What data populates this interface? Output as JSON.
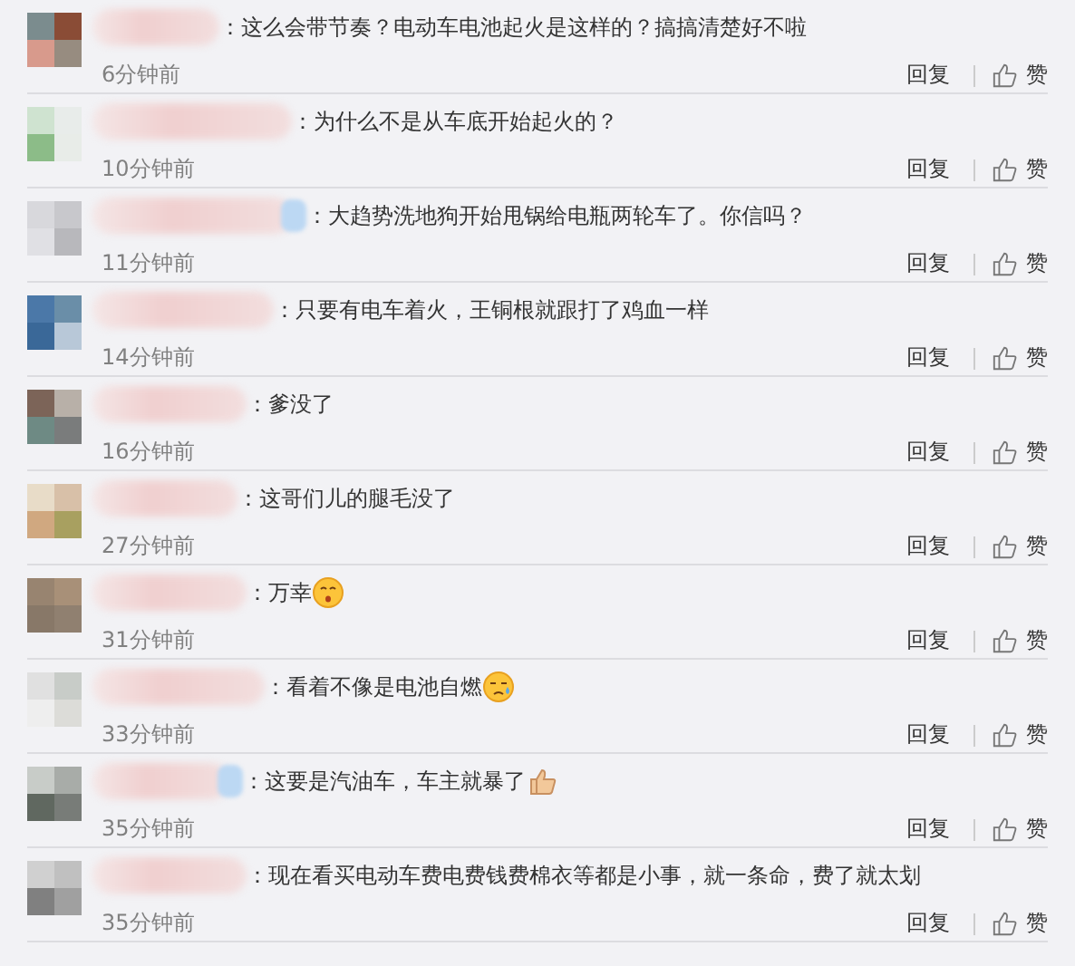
{
  "comments": [
    {
      "kind": "plain",
      "text": "：这么会带节奏？电动车电池起火是这样的？搞搞清楚好不啦",
      "time": "6分钟前",
      "reply": "回复",
      "like": "赞"
    },
    {
      "kind": "plain",
      "text": "：为什么不是从车底开始起火的？",
      "time": "10分钟前",
      "reply": "回复",
      "like": "赞"
    },
    {
      "kind": "plain",
      "text": "：大趋势洗地狗开始甩锅给电瓶两轮车了。你信吗？",
      "time": "11分钟前",
      "reply": "回复",
      "like": "赞"
    },
    {
      "kind": "plain",
      "text": "：只要有电车着火，王铜根就跟打了鸡血一样",
      "time": "14分钟前",
      "reply": "回复",
      "like": "赞"
    },
    {
      "kind": "plain",
      "text": "：爹没了",
      "time": "16分钟前",
      "reply": "回复",
      "like": "赞"
    },
    {
      "kind": "plain",
      "text": "：这哥们儿的腿毛没了",
      "time": "27分钟前",
      "reply": "回复",
      "like": "赞"
    },
    {
      "kind": "kiss",
      "text": "：万幸",
      "time": "31分钟前",
      "reply": "回复",
      "like": "赞"
    },
    {
      "kind": "sweat",
      "text": "：看着不像是电池自燃",
      "time": "33分钟前",
      "reply": "回复",
      "like": "赞"
    },
    {
      "kind": "thumb",
      "text": "：这要是汽油车，车主就暴了",
      "time": "35分钟前",
      "reply": "回复",
      "like": "赞"
    },
    {
      "kind": "plain",
      "text": "：现在看买电动车费电费钱费棉衣等都是小事，就一条命，费了就太划",
      "time": "35分钟前",
      "reply": "回复",
      "like": "赞"
    }
  ]
}
